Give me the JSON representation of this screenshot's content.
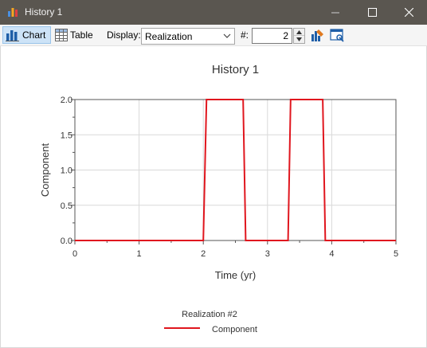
{
  "window": {
    "title": "History 1",
    "icon": "bar-chart-icon"
  },
  "toolbar": {
    "chart_label": "Chart",
    "table_label": "Table",
    "display_label": "Display:",
    "display_value": "Realization",
    "number_label": "#:",
    "number_value": "2"
  },
  "chart_data": {
    "type": "line",
    "title": "History 1",
    "xlabel": "Time (yr)",
    "ylabel": "Component",
    "xlim": [
      0,
      5
    ],
    "ylim": [
      0,
      2
    ],
    "xticks": [
      "0",
      "1",
      "2",
      "3",
      "4",
      "5"
    ],
    "yticks": [
      "0.0",
      "0.5",
      "1.0",
      "1.5",
      "2.0"
    ],
    "grid": true,
    "legend_title": "Realization #2",
    "legend_position": "bottom",
    "series": [
      {
        "name": "Component",
        "color": "#e0161e",
        "x": [
          0,
          2.0,
          2.05,
          2.62,
          2.66,
          3.32,
          3.36,
          3.86,
          3.9,
          5
        ],
        "y": [
          0,
          0,
          2,
          2,
          0,
          0,
          2,
          2,
          0,
          0
        ]
      }
    ]
  }
}
